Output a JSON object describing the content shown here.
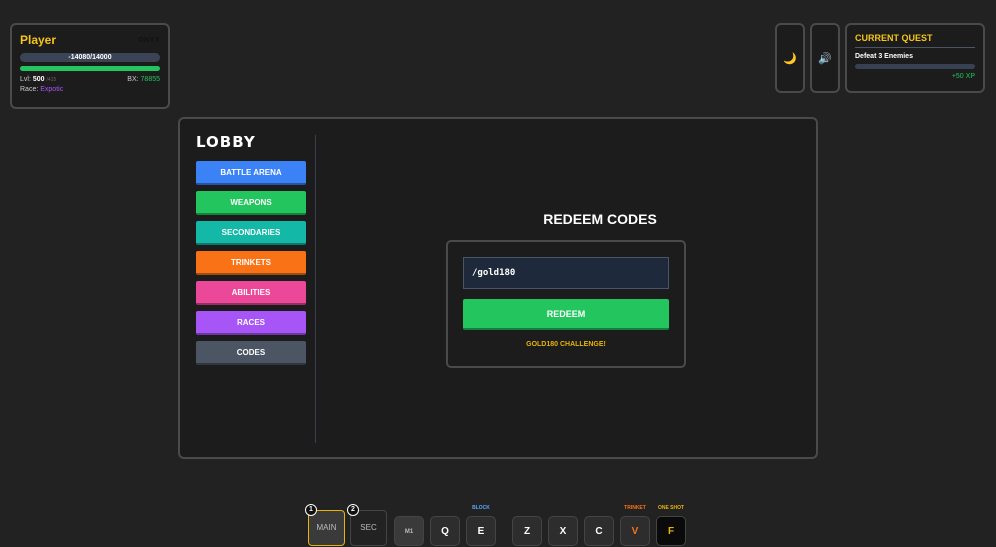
{
  "player": {
    "name": "Player",
    "tag": "ONYX",
    "hp": "-14080/14000",
    "level_label": "Lvl:",
    "level": "500",
    "level_sub": "/415",
    "bx_label": "BX:",
    "bx": "78855",
    "race_label": "Race:",
    "race": "Expotic"
  },
  "top_buttons": {
    "theme_icon": "moon-icon",
    "sound_icon": "speaker-icon"
  },
  "quest": {
    "title": "CURRENT QUEST",
    "desc": "Defeat 3 Enemies",
    "progress": 0,
    "reward": "+50 XP"
  },
  "lobby": {
    "title": "LOBBY",
    "menu": [
      {
        "label": "BATTLE ARENA",
        "color": "#3b82f6"
      },
      {
        "label": "WEAPONS",
        "color": "#22c55e"
      },
      {
        "label": "SECONDARIES",
        "color": "#14b8a6"
      },
      {
        "label": "TRINKETS",
        "color": "#f97316"
      },
      {
        "label": "ABILITIES",
        "color": "#ec4899"
      },
      {
        "label": "RACES",
        "color": "#a855f7"
      },
      {
        "label": "CODES",
        "color": "#4b5563"
      }
    ]
  },
  "redeem": {
    "title": "REDEEM CODES",
    "input_value": "/gold180",
    "button": "REDEEM",
    "message": "GOLD180 CHALLENGE!"
  },
  "hotbar": {
    "slots": [
      {
        "num": "1",
        "label": "MAIN"
      },
      {
        "num": "2",
        "label": "SEC"
      }
    ],
    "keys": [
      "M1",
      "Q",
      "E",
      "Z",
      "X",
      "C",
      "V",
      "F"
    ],
    "labels": {
      "E": "BLOCK",
      "V": "TRINKET",
      "F": "ONE SHOT"
    }
  }
}
